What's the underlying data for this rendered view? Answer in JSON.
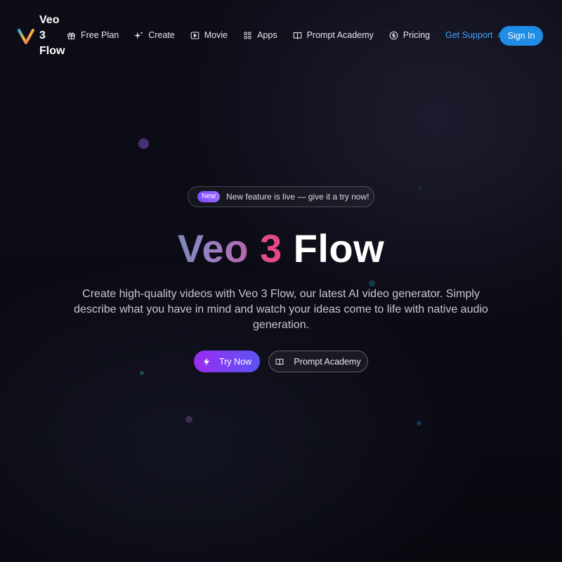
{
  "header": {
    "logo_text": "Veo 3 Flow",
    "nav": [
      {
        "label": "Free Plan",
        "icon": "gift-icon"
      },
      {
        "label": "Create",
        "icon": "sparkles-icon"
      },
      {
        "label": "Movie",
        "icon": "play-square-icon"
      },
      {
        "label": "Apps",
        "icon": "apps-grid-icon"
      },
      {
        "label": "Prompt Academy",
        "icon": "book-icon"
      },
      {
        "label": "Pricing",
        "icon": "dollar-circle-icon"
      },
      {
        "label": "Get Support",
        "icon": "arrow-up-right-icon"
      }
    ],
    "signin_label": "Sign In"
  },
  "hero": {
    "badge_pill": "New",
    "badge_text": "New feature is live — give it a try now!",
    "title_part1": "Veo ",
    "title_part2": "3",
    "title_part3": " Flow",
    "subtitle": "Create high-quality videos with Veo 3 Flow, our latest AI video generator. Simply describe what you have in mind and watch your ideas come to life with native audio generation.",
    "try_now_label": "Try Now",
    "try_now_icon": "bolt-icon",
    "academy_label": "Prompt Academy",
    "academy_icon": "book-icon"
  },
  "colors": {
    "background": "#0c0c16",
    "accent_blue": "#1f8ce6",
    "support_link": "#3ea6ff",
    "try_gradient_start": "#9b2cf0",
    "try_gradient_end": "#5a55f5"
  }
}
